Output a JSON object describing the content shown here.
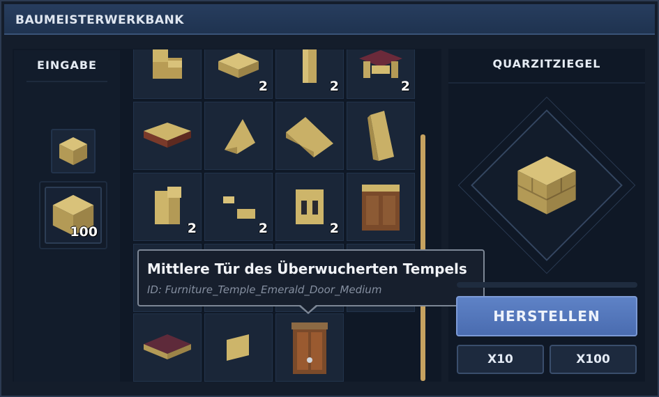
{
  "window": {
    "title": "BAUMEISTERWERKBANK"
  },
  "input": {
    "header": "EINGABE",
    "small_slot": {
      "icon": "sandstone-block-icon"
    },
    "big_slot": {
      "icon": "sandstone-block-icon",
      "count": "100"
    }
  },
  "grid": {
    "rows": [
      [
        {
          "icon": "stairs-icon",
          "count": ""
        },
        {
          "icon": "slab-icon",
          "count": "2"
        },
        {
          "icon": "pillar-icon",
          "count": "2"
        },
        {
          "icon": "table-icon",
          "count": "2"
        }
      ],
      [
        {
          "icon": "bench-icon",
          "count": ""
        },
        {
          "icon": "roof-slope-icon",
          "count": ""
        },
        {
          "icon": "roof-long-icon",
          "count": ""
        },
        {
          "icon": "roof-steep-icon",
          "count": ""
        }
      ],
      [
        {
          "icon": "wall-corner-icon",
          "count": "2"
        },
        {
          "icon": "bricks-small-icon",
          "count": "2"
        },
        {
          "icon": "window-wall-icon",
          "count": "2"
        },
        {
          "icon": "cabinet-icon",
          "count": ""
        }
      ],
      [
        {
          "icon": "bed-icon",
          "count": ""
        },
        {
          "icon": "panel-icon",
          "count": ""
        },
        {
          "icon": "temple-door-icon",
          "count": ""
        }
      ]
    ]
  },
  "tooltip": {
    "title": "Mittlere Tür des Überwucherten Tempels",
    "id": "ID: Furniture_Temple_Emerald_Door_Medium"
  },
  "result": {
    "header": "QUARZITZIEGEL",
    "icon": "quartzite-brick-block-icon"
  },
  "buttons": {
    "craft": "HERSTELLEN",
    "x10": "X10",
    "x100": "X100"
  },
  "colors": {
    "accent": "#5b7fc4",
    "scroll_thumb": "#c6a260",
    "panel": "#0f1826"
  }
}
